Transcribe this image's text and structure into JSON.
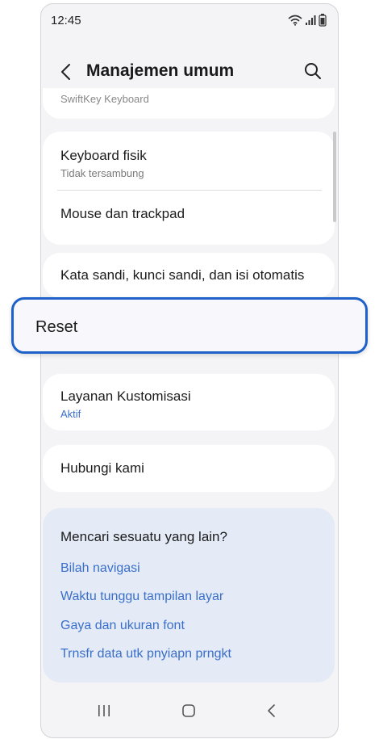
{
  "status_bar": {
    "time": "12:45"
  },
  "header": {
    "title": "Manajemen umum"
  },
  "peek_item": {
    "label": "SwiftKey Keyboard"
  },
  "items": {
    "keyboard_fisik": {
      "title": "Keyboard fisik",
      "subtitle": "Tidak tersambung"
    },
    "mouse": {
      "title": "Mouse dan trackpad"
    },
    "kata_sandi": {
      "title": "Kata sandi, kunci sandi, dan isi otomatis"
    },
    "reset": {
      "title": "Reset"
    },
    "layanan": {
      "title": "Layanan Kustomisasi",
      "subtitle": "Aktif"
    },
    "hubungi": {
      "title": "Hubungi kami"
    }
  },
  "suggestions": {
    "heading": "Mencari sesuatu yang lain?",
    "links": [
      "Bilah navigasi",
      "Waktu tunggu tampilan layar",
      "Gaya dan ukuran font",
      "Trnsfr data utk pnyiapn prngkt"
    ]
  },
  "icons": {
    "back": "chevron-left-icon",
    "search": "search-icon",
    "wifi": "wifi-icon",
    "signal": "signal-icon",
    "battery": "battery-icon",
    "recents": "recents-icon",
    "home": "home-icon",
    "nav_back": "nav-back-icon"
  },
  "colors": {
    "accent": "#1e62c9",
    "link": "#3a6fc9",
    "background": "#f4f4f6",
    "suggest_bg": "#e4ebf7"
  }
}
